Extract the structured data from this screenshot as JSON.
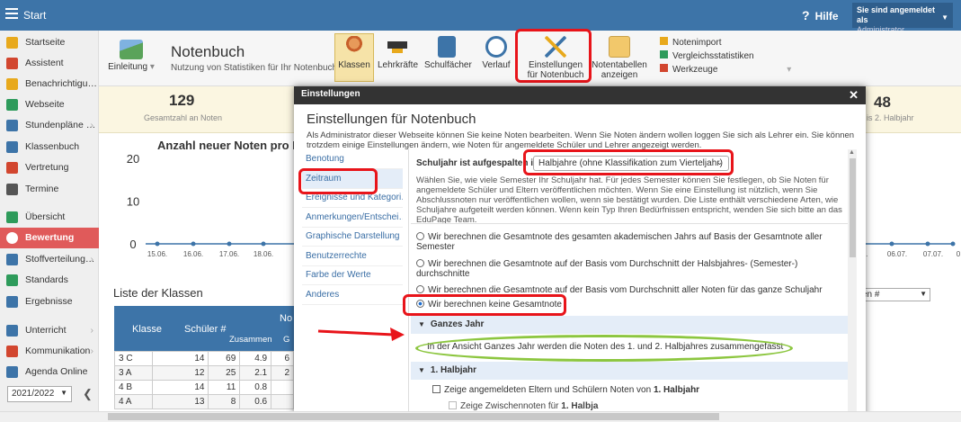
{
  "topbar": {
    "app_title": "Start",
    "help": "Hilfe",
    "user_line1": "Sie sind angemeldet als",
    "user_line2": "Administrator"
  },
  "sidebar": {
    "items": [
      {
        "label": "Startseite",
        "icon": "star-icon",
        "color": "#e8a91c"
      },
      {
        "label": "Assistent",
        "icon": "wand-icon",
        "color": "#d2462f"
      },
      {
        "label": "Benachrichtigu…",
        "icon": "envelope-icon",
        "color": "#e8a91c"
      },
      {
        "label": "Webseite",
        "icon": "house-icon",
        "color": "#2e9b5b"
      },
      {
        "label": "Stundenpläne …",
        "icon": "timetable-icon",
        "color": "#3d74a8"
      },
      {
        "label": "Klassenbuch",
        "icon": "book-icon",
        "color": "#3d74a8"
      },
      {
        "label": "Vertretung",
        "icon": "person-icon",
        "color": "#d2462f"
      },
      {
        "label": "Termine",
        "icon": "calendar-icon",
        "color": "#555555"
      },
      {
        "label": "Übersicht",
        "icon": "check-circle-icon",
        "color": "#2e9b5b"
      },
      {
        "label": "Bewertung",
        "icon": "grade-icon",
        "color": "#ffffff"
      },
      {
        "label": "Stoffverteilung…",
        "icon": "list-icon",
        "color": "#3d74a8"
      },
      {
        "label": "Standards",
        "icon": "shield-icon",
        "color": "#2e9b5b"
      },
      {
        "label": "Ergebnisse",
        "icon": "chart-icon",
        "color": "#3d74a8"
      },
      {
        "label": "Unterricht",
        "icon": "classroom-icon",
        "color": "#3d74a8"
      },
      {
        "label": "Kommunikation",
        "icon": "chat-icon",
        "color": "#d2462f"
      },
      {
        "label": "Agenda Online",
        "icon": "pen-icon",
        "color": "#3d74a8"
      }
    ],
    "year": "2021/2022"
  },
  "ribbon": {
    "intro_label": "Einleitung",
    "page_title": "Notenbuch",
    "page_subtitle": "Nutzung von Statistiken für Ihr Notenbuch",
    "buttons": [
      {
        "label": "Klassen",
        "icon": "students-icon"
      },
      {
        "label": "Lehrkräfte",
        "icon": "teacher-hat-icon"
      },
      {
        "label": "Schulfächer",
        "icon": "subjects-book-icon"
      },
      {
        "label": "Verlauf",
        "icon": "clock-icon"
      },
      {
        "label": "Einstellungen für Notenbuch",
        "line1": "Einstellungen",
        "line2": "für Notenbuch",
        "icon": "settings-tools-icon"
      },
      {
        "label": "Notentabellen anzeigen",
        "line1": "Notentabellen",
        "line2": "anzeigen",
        "icon": "folder-icon"
      }
    ],
    "links": [
      {
        "label": "Notenimport",
        "icon": "import-icon"
      },
      {
        "label": "Vergleichsstatistiken",
        "icon": "stats-icon"
      },
      {
        "label": "Werkzeuge",
        "icon": "tools-icon"
      }
    ]
  },
  "stats": {
    "left_value": "129",
    "left_label": "Gesamtzahl an Noten",
    "right_value": "48",
    "right_label": "is 2. Halbjahr"
  },
  "chart_data": {
    "type": "line",
    "title": "Anzahl neuer Noten pro D",
    "yticks": [
      "20",
      "10",
      "0"
    ],
    "ylim": [
      0,
      20
    ],
    "x_left": [
      "15.06.",
      "16.06.",
      "17.06.",
      "18.06."
    ],
    "x_right": [
      "7.",
      "06.07.",
      "07.07.",
      "0"
    ],
    "values": [
      0,
      0,
      0,
      0,
      0,
      0,
      0,
      0
    ]
  },
  "classes": {
    "title": "Liste der Klassen",
    "head_klasse": "Klasse",
    "head_schueler": "Schüler #",
    "head_no": "No",
    "head_zusammen": "Zusammen",
    "head_g": "G",
    "right_select": "en #",
    "rows": [
      {
        "k": "3 C",
        "s": "14",
        "z": "69",
        "d": "4.9",
        "e": "6"
      },
      {
        "k": "3 A",
        "s": "12",
        "z": "25",
        "d": "2.1",
        "e": "2"
      },
      {
        "k": "4 B",
        "s": "14",
        "z": "11",
        "d": "0.8",
        "e": ""
      },
      {
        "k": "4 A",
        "s": "13",
        "z": "8",
        "d": "0.6",
        "e": ""
      }
    ]
  },
  "modal": {
    "header": "Einstellungen",
    "title": "Einstellungen für Notenbuch",
    "description": "Als Administrator dieser Webseite können Sie keine Noten bearbeiten. Wenn Sie Noten ändern wollen loggen Sie sich als Lehrer ein. Sie können trotzdem einige Einstellungen ändern, wie Noten für angemeldete Schüler und Lehrer angezeigt werden.",
    "menu": [
      "Benotung",
      "Zeitraum",
      "Ereignisse und Kategori…",
      "Anmerkungen/Entschei…",
      "Graphische Darstellung",
      "Benutzerrechte",
      "Farbe der Werte",
      "Anderes"
    ],
    "split_label": "Schuljahr ist aufgespalten in:",
    "split_value": "Halbjahre (ohne Klassifikation zum Vierteljahr)",
    "split_description": "Wählen Sie, wie viele Semester Ihr Schuljahr hat. Für jedes Semester können Sie festlegen, ob Sie Noten für angemeldete Schüler und Eltern veröffentlichen möchten. Wenn Sie eine Einstellung ist nützlich, wenn Sie Abschlussnoten nur veröffentlichen wollen, wenn sie bestätigt wurden. Die Liste enthält verschiedene Arten, wie Schuljahre aufgeteilt werden können. Wenn kein Typ Ihren Bedürfnissen entspricht, wenden Sie sich bitte an das EduPage Team.",
    "options": [
      "Wir berechnen die Gesamtnote des gesamten akademischen Jahrs auf Basis der Gesamtnote aller Semester",
      "Wir berechnen die Gesamtnote auf der Basis vom Durchschnitt der Halsbjahres- (Semester-) durchschnitte",
      "Wir berechnen die Gesamtnote auf der Basis vom Durchschnitt aller Noten für das ganze Schuljahr",
      "Wir berechnen keine Gesamtnote"
    ],
    "selected_option": 3,
    "section1": "Ganzes Jahr",
    "section1_text": "In der Ansicht Ganzes Jahr werden die Noten des 1. und 2. Halbjahres zusammengefasst",
    "section2": "1. Halbjahr",
    "check1_prefix": "Zeige angemeldeten Eltern und Schülern Noten von ",
    "check1_bold": "1. Halbjahr",
    "check2_prefix": "Zeige Zwischennoten für ",
    "check2_bold": "1. Halbja"
  },
  "annotation_colors": {
    "red": "#e8141a",
    "green": "#8cc63f"
  }
}
